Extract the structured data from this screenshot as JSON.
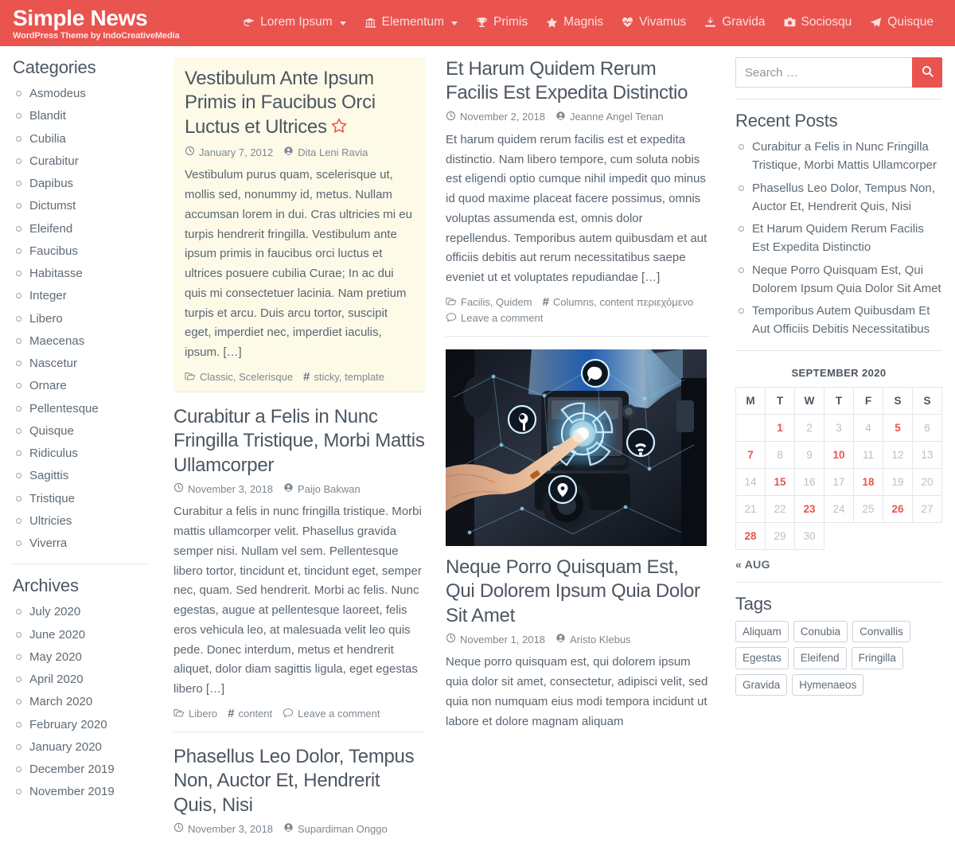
{
  "header": {
    "brand_title": "Simple News",
    "brand_subtitle": "WordPress Theme by IndoCreativeMedia",
    "brand_color": "#e9544f",
    "nav": [
      {
        "label": "Lorem Ipsum",
        "icon": "graduation-cap-icon",
        "has_dropdown": true
      },
      {
        "label": "Elementum",
        "icon": "bank-icon",
        "has_dropdown": true
      },
      {
        "label": "Primis",
        "icon": "trophy-icon",
        "has_dropdown": false
      },
      {
        "label": "Magnis",
        "icon": "star-icon",
        "has_dropdown": false
      },
      {
        "label": "Vivamus",
        "icon": "heartbeat-icon",
        "has_dropdown": false
      },
      {
        "label": "Gravida",
        "icon": "download-icon",
        "has_dropdown": false
      },
      {
        "label": "Sociosqu",
        "icon": "camera-icon",
        "has_dropdown": false
      },
      {
        "label": "Quisque",
        "icon": "paper-plane-icon",
        "has_dropdown": false
      }
    ]
  },
  "sidebar": {
    "categories": {
      "title": "Categories",
      "items": [
        "Asmodeus",
        "Blandit",
        "Cubilia",
        "Curabitur",
        "Dapibus",
        "Dictumst",
        "Eleifend",
        "Faucibus",
        "Habitasse",
        "Integer",
        "Libero",
        "Maecenas",
        "Nascetur",
        "Ornare",
        "Pellentesque",
        "Quisque",
        "Ridiculus",
        "Sagittis",
        "Tristique",
        "Ultricies",
        "Viverra"
      ]
    },
    "archives": {
      "title": "Archives",
      "items": [
        "July 2020",
        "June 2020",
        "May 2020",
        "April 2020",
        "March 2020",
        "February 2020",
        "January 2020",
        "December 2019",
        "November 2019"
      ]
    }
  },
  "column1": {
    "posts": [
      {
        "title": "Vestibulum Ante Ipsum Primis in Faucibus Orci Luctus et Ultrices",
        "sticky": true,
        "date": "January 7, 2012",
        "author": "Dita Leni Ravia",
        "excerpt": "Vestibulum purus quam, scelerisque ut, mollis sed, nonummy id, metus. Nullam accumsan lorem in dui. Cras ultricies mi eu turpis hendrerit fringilla. Vestibulum ante ipsum primis in faucibus orci luctus et ultrices posuere cubilia Curae; In ac dui quis mi consectetuer lacinia. Nam pretium turpis et arcu. Duis arcu tortor, suscipit eget, imperdiet nec, imperdiet iaculis, ipsum. […]",
        "categories": "Classic, Scelerisque",
        "tags": "sticky, template",
        "comments": null
      },
      {
        "title": "Curabitur a Felis in Nunc Fringilla Tristique, Morbi Mattis Ullamcorper",
        "sticky": false,
        "date": "November 3, 2018",
        "author": "Paijo Bakwan",
        "excerpt": "Curabitur a felis in nunc fringilla tristique. Morbi mattis ullamcorper velit. Phasellus gravida semper nisi. Nullam vel sem. Pellentesque libero tortor, tincidunt et, tincidunt eget, semper nec, quam. Sed hendrerit. Morbi ac felis. Nunc egestas, augue at pellentesque laoreet, felis eros vehicula leo, at malesuada velit leo quis pede. Donec interdum, metus et hendrerit aliquet, dolor diam sagittis ligula, eget egestas libero […]",
        "categories": "Libero",
        "tags": "content",
        "comments": "Leave a comment"
      },
      {
        "title": "Phasellus Leo Dolor, Tempus Non, Auctor Et, Hendrerit Quis, Nisi",
        "sticky": false,
        "date": "November 3, 2018",
        "author": "Supardiman Onggo",
        "excerpt": "",
        "categories": "",
        "tags": "",
        "comments": null
      }
    ]
  },
  "column2": {
    "posts": [
      {
        "title": "Et Harum Quidem Rerum Facilis Est Expedita Distinctio",
        "date": "November 2, 2018",
        "author": "Jeanne Angel Tenan",
        "excerpt": "Et harum quidem rerum facilis est et expedita distinctio. Nam libero tempore, cum soluta nobis est eligendi optio cumque nihil impedit quo minus id quod maxime placeat facere possimus, omnis voluptas assumenda est, omnis dolor repellendus. Temporibus autem quibusdam et aut officiis debitis aut rerum necessitatibus saepe eveniet ut et voluptates repudiandae […]",
        "categories": "Facilis, Quidem",
        "tags": "Columns, content περιεχόμενο",
        "comments": "Leave a comment",
        "has_image": false
      },
      {
        "title": "Neque Porro Quisquam Est, Qui Dolorem Ipsum Quia Dolor Sit Amet",
        "date": "November 1, 2018",
        "author": "Aristo Klebus",
        "excerpt": "Neque porro quisquam est, qui dolorem ipsum quia dolor sit amet, consectetur, adipisci velit, sed quia non numquam eius modi tempora incidunt ut labore et dolore magnam aliquam",
        "categories": "",
        "tags": "",
        "comments": null,
        "has_image": true,
        "image_alt": "Hand touching a car dashboard infotainment screen with glowing blue connected-car icons"
      }
    ]
  },
  "widgets": {
    "search": {
      "placeholder": "Search …",
      "value": "",
      "button_icon": "search-icon"
    },
    "recent_posts": {
      "title": "Recent Posts",
      "items": [
        "Curabitur a Felis in Nunc Fringilla Tristique, Morbi Mattis Ullamcorper",
        "Phasellus Leo Dolor, Tempus Non, Auctor Et, Hendrerit Quis, Nisi",
        "Et Harum Quidem Rerum Facilis Est Expedita Distinctio",
        "Neque Porro Quisquam Est, Qui Dolorem Ipsum Quia Dolor Sit Amet",
        "Temporibus Autem Quibusdam Et Aut Officiis Debitis Necessitatibus"
      ]
    },
    "calendar": {
      "caption": "SEPTEMBER 2020",
      "weekdays": [
        "M",
        "T",
        "W",
        "T",
        "F",
        "S",
        "S"
      ],
      "leading_blanks": 1,
      "days": [
        1,
        2,
        3,
        4,
        5,
        6,
        7,
        8,
        9,
        10,
        11,
        12,
        13,
        14,
        15,
        16,
        17,
        18,
        19,
        20,
        21,
        22,
        23,
        24,
        25,
        26,
        27,
        28,
        29,
        30
      ],
      "days_with_posts": [
        1,
        5,
        7,
        10,
        15,
        18,
        23,
        26,
        28
      ],
      "prev_label": "« AUG",
      "post_day_color": "#e9544f"
    },
    "tags": {
      "title": "Tags",
      "items": [
        "Aliquam",
        "Conubia",
        "Convallis",
        "Egestas",
        "Eleifend",
        "Fringilla",
        "Gravida",
        "Hymenaeos"
      ]
    }
  }
}
